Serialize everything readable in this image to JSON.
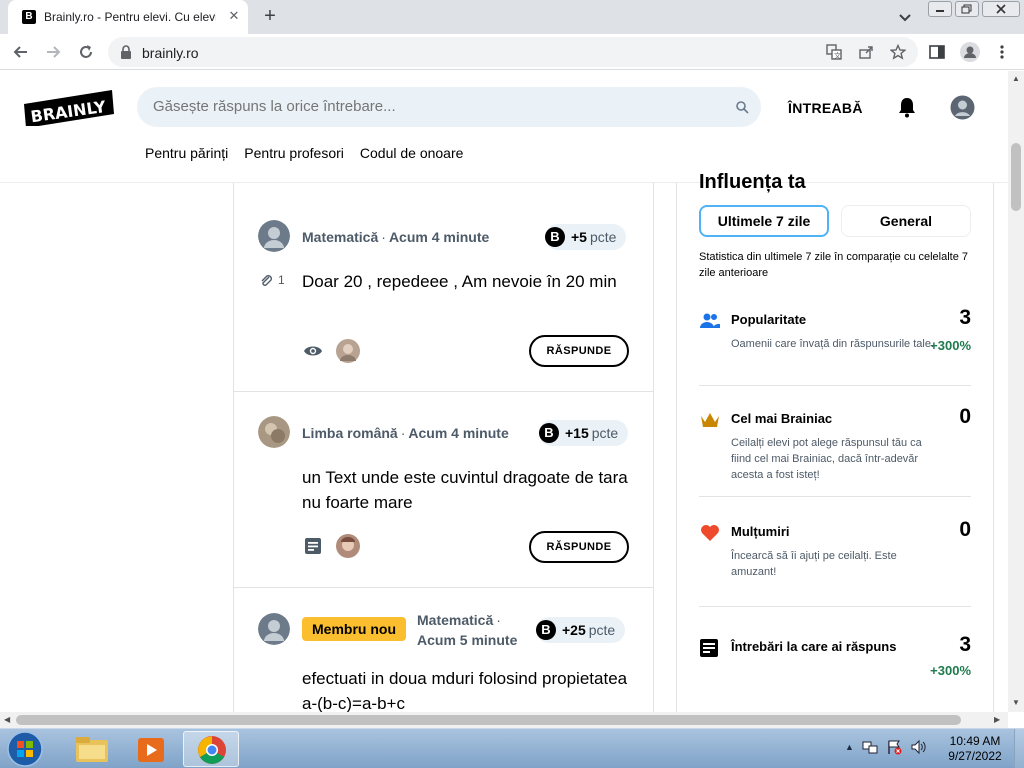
{
  "browser": {
    "tab_title": "Brainly.ro - Pentru elevi. Cu elevi.",
    "tab_favicon": "B",
    "url": "brainly.ro"
  },
  "header": {
    "logo_text": "BRAINLY",
    "search_placeholder": "Găsește răspuns la orice întrebare...",
    "ask_label": "ÎNTREABĂ",
    "nav_links": [
      "Pentru părinți",
      "Pentru profesori",
      "Codul de onoare"
    ]
  },
  "questions": [
    {
      "subject": "Matematică",
      "time": "Acum 4 minute",
      "points_value": "+5",
      "points_unit": "pcte",
      "attachments": "1",
      "text": "Doar 20 , repedeee , Am nevoie în 20 min",
      "answer_label": "RĂSPUNDE"
    },
    {
      "subject": "Limba română",
      "time": "Acum 4 minute",
      "points_value": "+15",
      "points_unit": "pcte",
      "text": "un Text unde este cuvintul dragoate de tara nu foarte mare",
      "answer_label": "RĂSPUNDE"
    },
    {
      "badge": "Membru nou",
      "subject": "Matematică",
      "time": "Acum 5 minute",
      "points_value": "+25",
      "points_unit": "pcte",
      "text": "efectuati in doua mduri folosind propietatea a-(b-c)=a-b+c"
    }
  ],
  "stats": {
    "title": "Influența ta",
    "tab_week": "Ultimele 7 zile",
    "tab_general": "General",
    "description": "Statistica din ultimele 7 zile în comparație cu celelalte 7 zile anterioare",
    "rows": [
      {
        "title": "Popularitate",
        "value": "3",
        "desc": "Oamenii care învață din răspunsurile tale.",
        "change": "+300%",
        "icon": "people-icon",
        "color": "#1a73e8"
      },
      {
        "title": "Cel mai Brainiac",
        "value": "0",
        "desc": "Ceilalți elevi pot alege răspunsul tău ca fiind cel mai Brainiac, dacă într-adevăr acesta a fost isteț!",
        "icon": "crown-icon",
        "color": "#c98600"
      },
      {
        "title": "Mulțumiri",
        "value": "0",
        "desc": "Încearcă să îi ajuți pe ceilalți. Este amuzant!",
        "icon": "heart-icon",
        "color": "#ef4a2b"
      },
      {
        "title": "Întrebări la care ai răspuns",
        "value": "3",
        "change": "+300%",
        "icon": "answers-icon"
      }
    ]
  },
  "taskbar": {
    "time": "10:49 AM",
    "date": "9/27/2022"
  }
}
